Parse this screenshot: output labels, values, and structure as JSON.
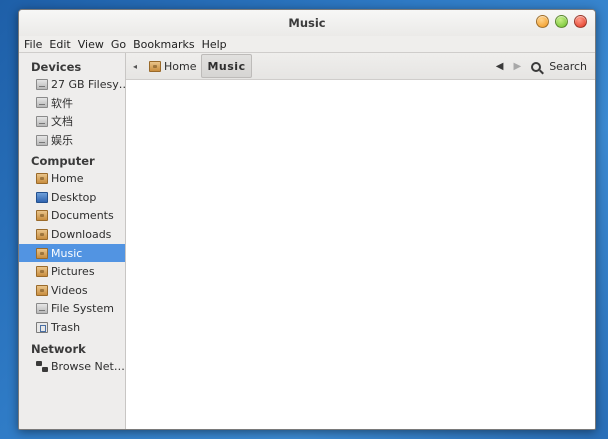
{
  "window": {
    "title": "Music",
    "controls": [
      "minimize",
      "maximize",
      "close"
    ]
  },
  "menubar": {
    "items": [
      "File",
      "Edit",
      "View",
      "Go",
      "Bookmarks",
      "Help"
    ]
  },
  "sidebar": {
    "sections": [
      {
        "header": "Devices",
        "items": [
          {
            "label": "27 GB Filesy…",
            "icon": "drive-icon"
          },
          {
            "label": "软件",
            "icon": "drive-icon"
          },
          {
            "label": "文档",
            "icon": "drive-icon"
          },
          {
            "label": "娱乐",
            "icon": "drive-icon"
          }
        ]
      },
      {
        "header": "Computer",
        "items": [
          {
            "label": "Home",
            "icon": "home-folder-icon"
          },
          {
            "label": "Desktop",
            "icon": "desktop-icon"
          },
          {
            "label": "Documents",
            "icon": "documents-folder-icon"
          },
          {
            "label": "Downloads",
            "icon": "downloads-folder-icon"
          },
          {
            "label": "Music",
            "icon": "music-folder-icon",
            "selected": true
          },
          {
            "label": "Pictures",
            "icon": "pictures-folder-icon"
          },
          {
            "label": "Videos",
            "icon": "videos-folder-icon"
          },
          {
            "label": "File System",
            "icon": "drive-icon"
          },
          {
            "label": "Trash",
            "icon": "trash-icon"
          }
        ]
      },
      {
        "header": "Network",
        "items": [
          {
            "label": "Browse Net…",
            "icon": "network-icon"
          }
        ]
      }
    ]
  },
  "toolbar": {
    "breadcrumbs": [
      {
        "label": "Home",
        "icon": "home-folder-icon"
      },
      {
        "label": "Music",
        "active": true
      }
    ],
    "back_icon": "back-arrow-icon",
    "forward_icon": "forward-arrow-icon",
    "search_label": "Search"
  },
  "colors": {
    "selection": "#5294e2",
    "desktop_background": "#2f7bc6"
  }
}
